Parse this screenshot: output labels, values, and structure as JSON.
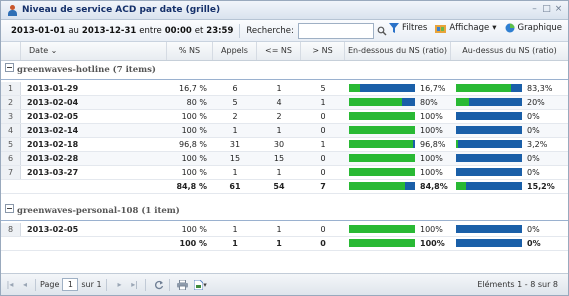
{
  "window": {
    "title": "Niveau de service ACD par date (grille)",
    "buttons": [
      "–",
      "□",
      "×"
    ]
  },
  "toolbar": {
    "date_from": "2013-01-01",
    "date_to_word": "au",
    "date_to": "2013-12-31",
    "entre_word": "entre",
    "time_from": "00:00",
    "et_word": "et",
    "time_to": "23:59",
    "search_label": "Recherche:",
    "search_value": "",
    "filters_label": "Filtres",
    "display_label": "Affichage",
    "chart_label": "Graphique"
  },
  "columns": [
    "Date",
    "% NS",
    "Appels",
    "<= NS",
    "> NS",
    "En-dessous du NS (ratio)",
    "Au-dessus du NS (ratio)"
  ],
  "groups": [
    {
      "label": "greenwaves-hotline (7 items)",
      "rows": [
        {
          "num": "1",
          "date": "2013-01-29",
          "ns": "16,7 %",
          "calls": "6",
          "le": "1",
          "gt": "5",
          "below": "16,7%",
          "below_v": 16.7,
          "above": "83,3%",
          "above_v": 83.3
        },
        {
          "num": "2",
          "date": "2013-02-04",
          "ns": "80 %",
          "calls": "5",
          "le": "4",
          "gt": "1",
          "below": "80%",
          "below_v": 80,
          "above": "20%",
          "above_v": 20
        },
        {
          "num": "3",
          "date": "2013-02-05",
          "ns": "100 %",
          "calls": "2",
          "le": "2",
          "gt": "0",
          "below": "100%",
          "below_v": 100,
          "above": "0%",
          "above_v": 0
        },
        {
          "num": "4",
          "date": "2013-02-14",
          "ns": "100 %",
          "calls": "1",
          "le": "1",
          "gt": "0",
          "below": "100%",
          "below_v": 100,
          "above": "0%",
          "above_v": 0
        },
        {
          "num": "5",
          "date": "2013-02-18",
          "ns": "96,8 %",
          "calls": "31",
          "le": "30",
          "gt": "1",
          "below": "96,8%",
          "below_v": 96.8,
          "above": "3,2%",
          "above_v": 3.2
        },
        {
          "num": "6",
          "date": "2013-02-28",
          "ns": "100 %",
          "calls": "15",
          "le": "15",
          "gt": "0",
          "below": "100%",
          "below_v": 100,
          "above": "0%",
          "above_v": 0
        },
        {
          "num": "7",
          "date": "2013-03-27",
          "ns": "100 %",
          "calls": "1",
          "le": "1",
          "gt": "0",
          "below": "100%",
          "below_v": 100,
          "above": "0%",
          "above_v": 0
        }
      ],
      "total": {
        "ns": "84,8 %",
        "calls": "61",
        "le": "54",
        "gt": "7",
        "below": "84,8%",
        "below_v": 84.8,
        "above": "15,2%",
        "above_v": 15.2
      }
    },
    {
      "label": "greenwaves-personal-108 (1 item)",
      "rows": [
        {
          "num": "8",
          "date": "2013-02-05",
          "ns": "100 %",
          "calls": "1",
          "le": "1",
          "gt": "0",
          "below": "100%",
          "below_v": 100,
          "above": "0%",
          "above_v": 0
        }
      ],
      "total": {
        "ns": "100 %",
        "calls": "1",
        "le": "1",
        "gt": "0",
        "below": "100%",
        "below_v": 100,
        "above": "0%",
        "above_v": 0
      }
    }
  ],
  "paging": {
    "page_label": "Page",
    "page_value": "1",
    "of_label": "sur 1",
    "info": "Eléments 1 - 8 sur 8"
  },
  "colors": {
    "below_fill": "#29b934",
    "bar_bg": "#1a5fa8"
  }
}
